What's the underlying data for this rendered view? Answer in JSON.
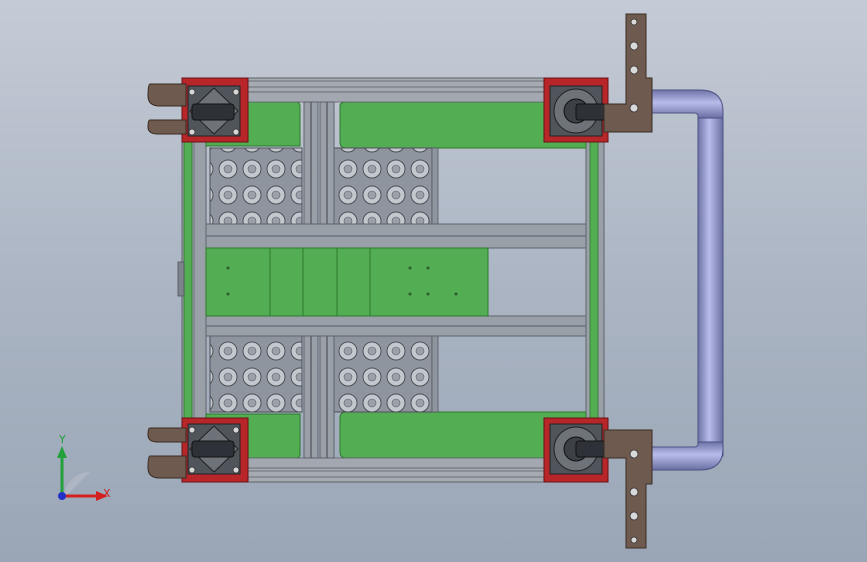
{
  "viewport": {
    "background_top": "#c5cbd6",
    "background_bottom": "#9aa6b6"
  },
  "model": {
    "colors": {
      "extrusion": "#9aa0a8",
      "extrusion_dark": "#6d737c",
      "panel_green": "#53ad53",
      "panel_green_dark": "#2e7a2e",
      "corner_plate_red": "#b8262a",
      "caster": "#3b3f45",
      "bracket_brown": "#6e5a4e",
      "handle_tube": "#8f93c9",
      "roller": "#b7bcc4"
    },
    "icons": [
      "caster-wheel-icon",
      "handle-icon",
      "coordinate-triad-icon"
    ]
  },
  "triad": {
    "x_label": "X",
    "y_label": "Y",
    "x_color": "#d22020",
    "y_color": "#22a03a",
    "origin_color": "#2530c8"
  }
}
